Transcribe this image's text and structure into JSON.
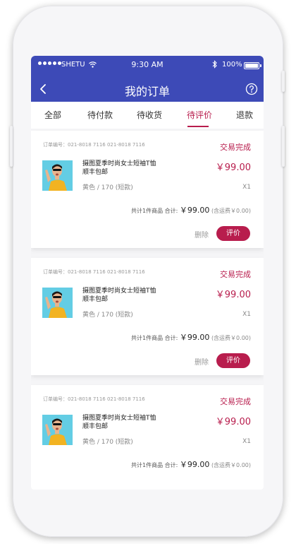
{
  "status_bar": {
    "carrier": "SHETU",
    "time": "9:30 AM",
    "battery": "100%"
  },
  "header": {
    "title": "我的订单",
    "back_icon": "chevron-left-icon",
    "help_icon": "question-circle-icon"
  },
  "tabs": [
    {
      "label": "全部",
      "active": false
    },
    {
      "label": "待付款",
      "active": false
    },
    {
      "label": "待收货",
      "active": false
    },
    {
      "label": "待评价",
      "active": true
    },
    {
      "label": "退款",
      "active": false
    }
  ],
  "colors": {
    "header_bg": "#3d4ab7",
    "accent": "#b81d4d"
  },
  "orders": [
    {
      "order_no": "订单编号：021-8018 7116 021-8018 7116",
      "status": "交易完成",
      "product": {
        "name_line1": "摄图夏季时尚女士短袖T恤",
        "name_line2": "顺丰包邮",
        "spec": "黄色 / 170 (短款)",
        "price": "￥99.00",
        "qty": "X1"
      },
      "summary": {
        "count_text": "共计1件商品 合计:",
        "total": "￥99.00",
        "shipping": "(含运费￥0.00)"
      },
      "actions": {
        "delete": "删除",
        "review": "评价"
      }
    },
    {
      "order_no": "订单编号：021-8018 7116 021-8018 7116",
      "status": "交易完成",
      "product": {
        "name_line1": "摄图夏季时尚女士短袖T恤",
        "name_line2": "顺丰包邮",
        "spec": "黄色 / 170 (短款)",
        "price": "￥99.00",
        "qty": "X1"
      },
      "summary": {
        "count_text": "共计1件商品 合计:",
        "total": "￥99.00",
        "shipping": "(含运费￥0.00)"
      },
      "actions": {
        "delete": "删除",
        "review": "评价"
      }
    },
    {
      "order_no": "订单编号：021-8018 7116 021-8018 7116",
      "status": "交易完成",
      "product": {
        "name_line1": "摄图夏季时尚女士短袖T恤",
        "name_line2": "顺丰包邮",
        "spec": "黄色 / 170 (短款)",
        "price": "￥99.00",
        "qty": "X1"
      },
      "summary": {
        "count_text": "共计1件商品 合计:",
        "total": "￥99.00",
        "shipping": "(含运费￥0.00)"
      }
    }
  ]
}
